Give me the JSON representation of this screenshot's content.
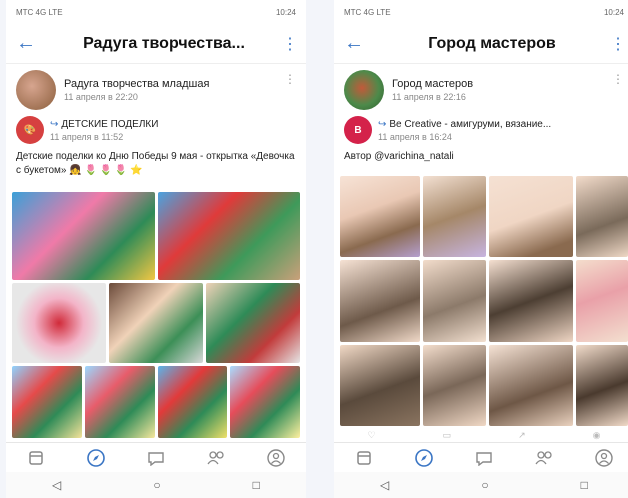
{
  "left": {
    "status": {
      "carrier": "МТС 4G LTE",
      "time": "10:24"
    },
    "appbar": {
      "title": "Радуга творчества..."
    },
    "source": {
      "name": "Радуга творчества младшая",
      "date": "11 апреля в 22:20"
    },
    "repost": {
      "name": "ДЕТСКИЕ ПОДЕЛКИ",
      "date": "11 апреля в 11:52"
    },
    "post_text": "Детские поделки ко Дню Победы 9 мая - открытка «Девочка с букетом» 👧 🌷 🌷 🌷 ⭐"
  },
  "right": {
    "status": {
      "carrier": "МТС 4G LTE",
      "time": "10:24"
    },
    "appbar": {
      "title": "Город мастеров"
    },
    "source": {
      "name": "Город мастеров",
      "date": "11 апреля в 22:16"
    },
    "repost": {
      "name": "Be Creative - амигуруми, вязание...",
      "date": "11 апреля в 16:24"
    },
    "post_text": "Автор @varichina_natali"
  },
  "colors": {
    "accent": "#3a75c4"
  }
}
